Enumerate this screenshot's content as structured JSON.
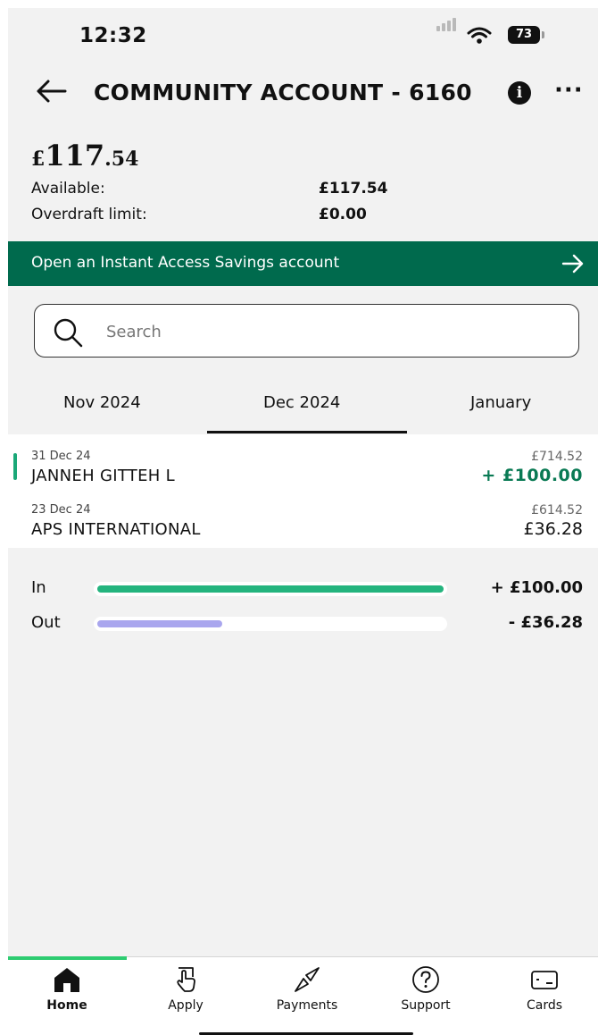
{
  "status_bar": {
    "time": "12:32",
    "battery": "73"
  },
  "header": {
    "title": "COMMUNITY ACCOUNT - 6160",
    "back_icon": "arrow-left-icon",
    "info_icon": "info-icon",
    "more_icon": "more-horizontal-icon"
  },
  "balance": {
    "currency": "£",
    "pounds": "117",
    "pence": ".54"
  },
  "details": [
    {
      "label": "Available:",
      "value": "£117.54"
    },
    {
      "label": "Overdraft limit:",
      "value": "£0.00"
    }
  ],
  "promo": {
    "text": "Open an Instant Access Savings account",
    "background": "#006a4d"
  },
  "search": {
    "placeholder": "Search",
    "value": ""
  },
  "tabs": [
    {
      "label": "Nov 2024",
      "selected": false
    },
    {
      "label": "Dec 2024",
      "selected": true
    },
    {
      "label": "January",
      "selected": false
    }
  ],
  "transactions": [
    {
      "date": "31 Dec 24",
      "name": "JANNEH GITTEH L",
      "running_balance": "£714.52",
      "amount": "+ £100.00",
      "direction": "in"
    },
    {
      "date": "23 Dec 24",
      "name": "APS INTERNATIONAL",
      "running_balance": "£614.52",
      "amount": "£36.28",
      "direction": "out"
    }
  ],
  "summary": {
    "in": {
      "label": "In",
      "value": "+ £100.00",
      "fraction": 1.0,
      "color": "#24b47e"
    },
    "out": {
      "label": "Out",
      "value": "- £36.28",
      "fraction": 0.36,
      "color": "#a9a6ee"
    }
  },
  "bottom_nav": [
    {
      "label": "Home",
      "icon": "home-icon",
      "active": true
    },
    {
      "label": "Apply",
      "icon": "hand-pointer-icon",
      "active": false
    },
    {
      "label": "Payments",
      "icon": "payments-arrows-icon",
      "active": false
    },
    {
      "label": "Support",
      "icon": "question-circle-icon",
      "active": false
    },
    {
      "label": "Cards",
      "icon": "card-icon",
      "active": false
    }
  ],
  "colors": {
    "accent_green": "#006a4d",
    "in_green": "#0a7a54",
    "nav_active": "#2ecc71"
  }
}
